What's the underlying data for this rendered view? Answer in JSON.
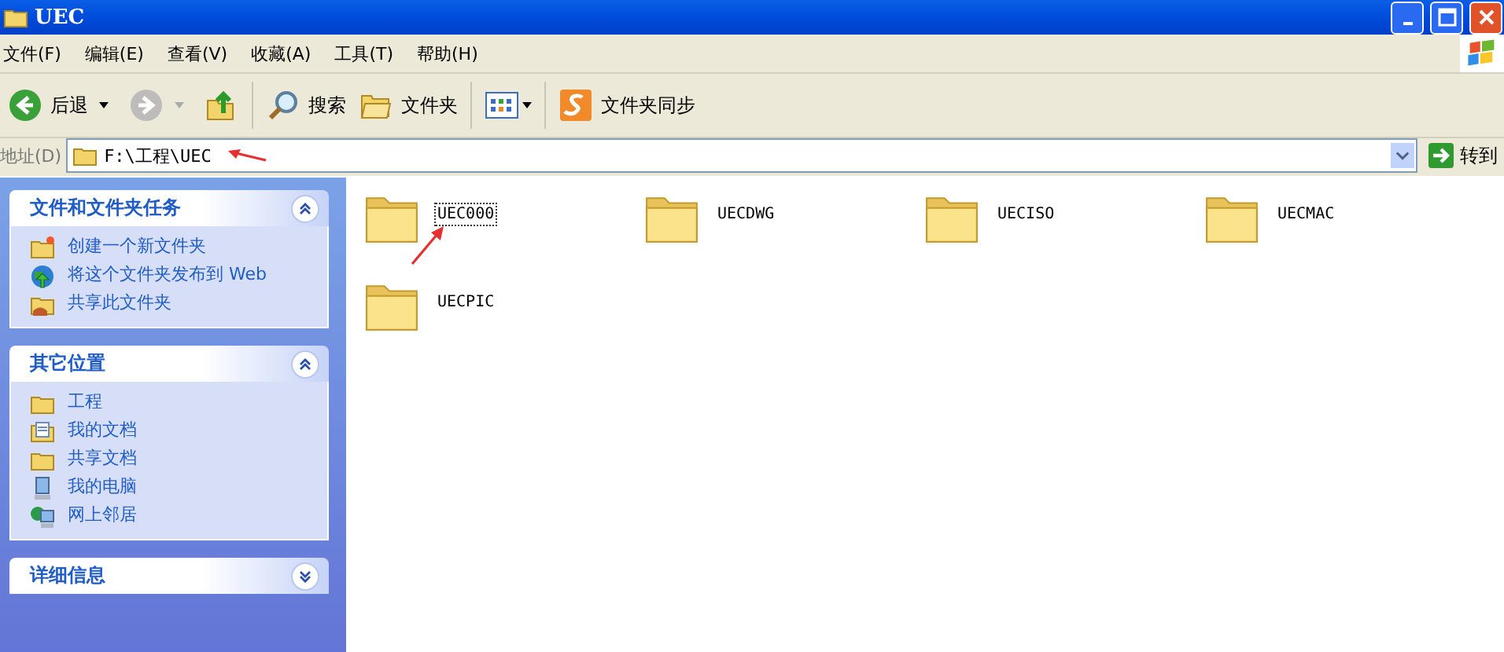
{
  "window": {
    "title": "UEC"
  },
  "menu": [
    "文件(F)",
    "编辑(E)",
    "查看(V)",
    "收藏(A)",
    "工具(T)",
    "帮助(H)"
  ],
  "toolbar": {
    "back": {
      "label": "后退",
      "disabled": false
    },
    "forward": {
      "disabled": true
    },
    "search": "搜索",
    "folders": "文件夹",
    "sync": "文件夹同步"
  },
  "address": {
    "label": "地址(D)",
    "value": "F:\\工程\\UEC",
    "go": "转到"
  },
  "sidebar": [
    {
      "title": "文件和文件夹任务",
      "expanded": true,
      "items": [
        {
          "kind": "new-folder",
          "label": "创建一个新文件夹"
        },
        {
          "kind": "publish",
          "label": "将这个文件夹发布到 Web"
        },
        {
          "kind": "share",
          "label": "共享此文件夹"
        }
      ]
    },
    {
      "title": "其它位置",
      "expanded": true,
      "items": [
        {
          "kind": "folder",
          "label": "工程"
        },
        {
          "kind": "documents",
          "label": "我的文档"
        },
        {
          "kind": "folder",
          "label": "共享文档"
        },
        {
          "kind": "computer",
          "label": "我的电脑"
        },
        {
          "kind": "network",
          "label": "网上邻居"
        }
      ]
    },
    {
      "title": "详细信息",
      "expanded": false
    }
  ],
  "folders": [
    {
      "name": "UEC000",
      "selected": true
    },
    {
      "name": "UECDWG",
      "selected": false
    },
    {
      "name": "UECISO",
      "selected": false
    },
    {
      "name": "UECMAC",
      "selected": false
    },
    {
      "name": "UECPIC",
      "selected": false
    }
  ]
}
